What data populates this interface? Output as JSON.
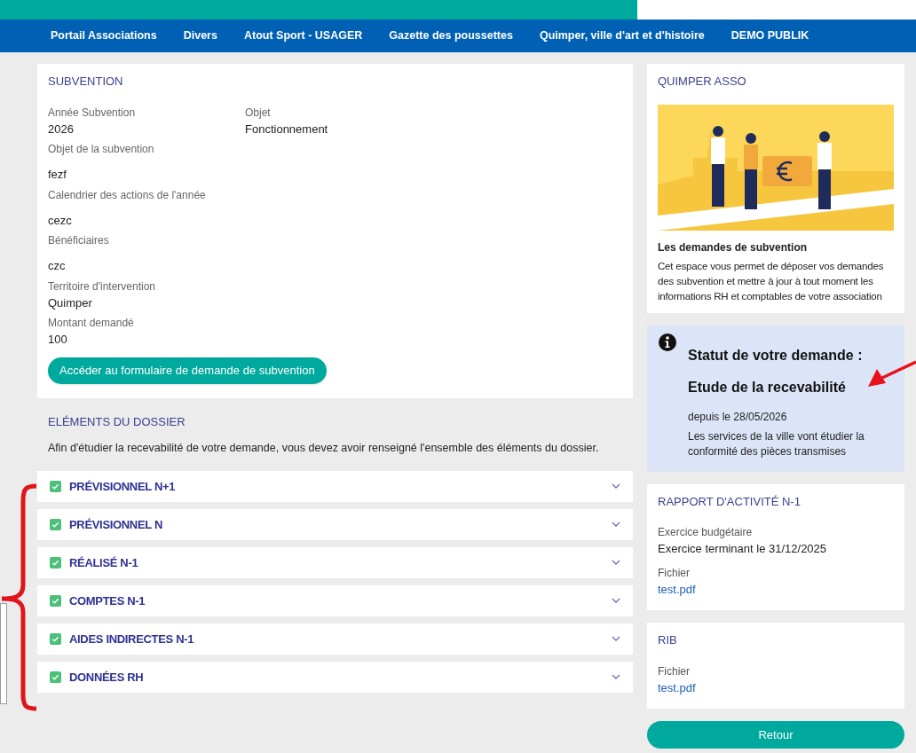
{
  "nav": {
    "items": [
      "Portail Associations",
      "Divers",
      "Atout Sport - USAGER",
      "Gazette des poussettes",
      "Quimper, ville d'art et d'histoire",
      "DEMO PUBLIK"
    ]
  },
  "subvention": {
    "title": "SUBVENTION",
    "fields": [
      {
        "label": "Année Subvention",
        "value": "2026",
        "kind": "pair"
      },
      {
        "label": "Objet",
        "value": "Fonctionnement",
        "kind": "pair"
      },
      {
        "label": "Objet de la subvention",
        "value": "fezf",
        "kind": "spaced"
      },
      {
        "label": "Calendrier des actions de l'année",
        "value": "cezc",
        "kind": "spaced"
      },
      {
        "label": "Bénéficiaires",
        "value": "czc",
        "kind": "spaced"
      },
      {
        "label": "Territoire d'intervention",
        "value": "Quimper",
        "kind": "tight"
      },
      {
        "label": "Montant demandé",
        "value": "100",
        "kind": "tight"
      }
    ],
    "button": "Accéder au formulaire de demande de subvention"
  },
  "dossier": {
    "title": "ELÉMENTS DU DOSSIER",
    "intro": "Afin d'étudier la recevabilité de votre demande, vous devez avoir renseigné l'ensemble des éléments du dossier.",
    "sections": [
      {
        "label": "PRÉVISIONNEL N+1",
        "checked": true,
        "expanded": false
      },
      {
        "label": "PRÉVISIONNEL N",
        "checked": true,
        "expanded": false
      },
      {
        "label": "RÉALISÉ N-1",
        "checked": true,
        "expanded": false
      },
      {
        "label": "COMPTES N-1",
        "checked": true,
        "expanded": false
      },
      {
        "label": "AIDES INDIRECTES N-1",
        "checked": true,
        "expanded": false
      },
      {
        "label": "DONNÉES RH",
        "checked": true,
        "expanded": false
      }
    ]
  },
  "asso": {
    "title": "QUIMPER ASSO",
    "heading": "Les demandes de subvention",
    "text": "Cet espace vous permet de déposer vos demandes des subvention et mettre à jour à tout moment les informations RH et comptables de votre association"
  },
  "status": {
    "title": "Statut de votre demande :",
    "value": "Etude de la recevabilité",
    "since": "depuis le 28/05/2026",
    "text": "Les services de la ville vont étudier la conformité des pièces transmises"
  },
  "rapport": {
    "title": "RAPPORT D'ACTIVITÉ N-1",
    "fields": [
      {
        "label": "Exercice budgétaire",
        "value": "Exercice terminant le 31/12/2025",
        "kind": "text"
      },
      {
        "label": "Fichier",
        "value": "test.pdf",
        "kind": "link"
      }
    ]
  },
  "rib": {
    "title": "RIB",
    "fields": [
      {
        "label": "Fichier",
        "value": "test.pdf",
        "kind": "link"
      }
    ]
  },
  "back_button": "Retour"
}
